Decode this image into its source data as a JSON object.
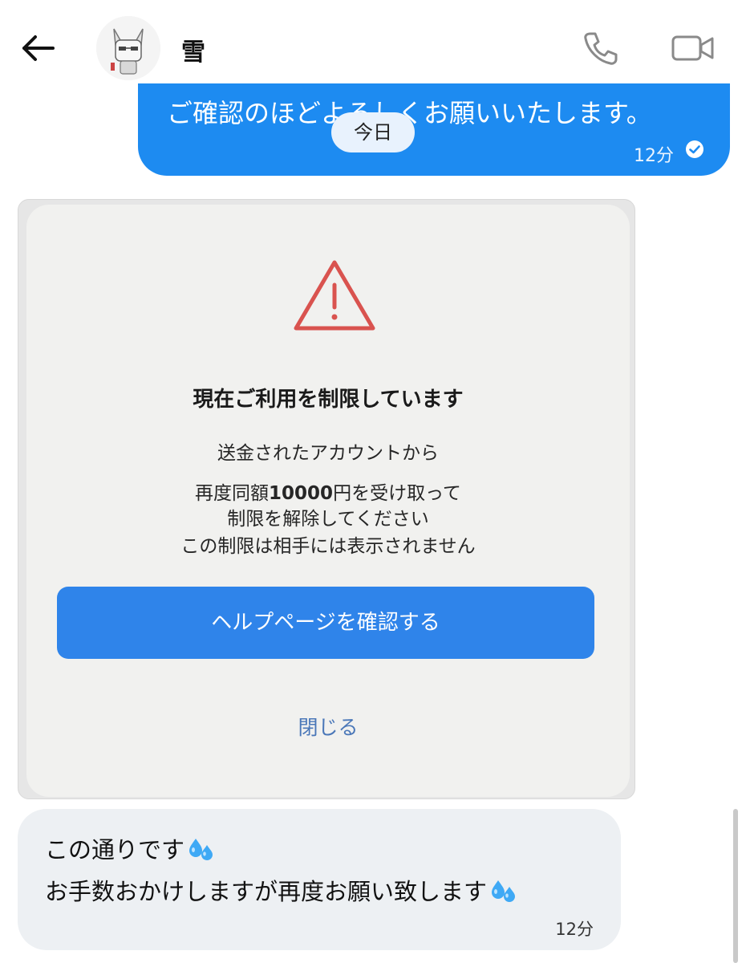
{
  "header": {
    "back_icon": "arrow-left-icon",
    "contact_name": "雪",
    "call_icon": "phone-icon",
    "video_icon": "video-camera-icon"
  },
  "messages": {
    "outgoing": {
      "text": "ご確認のほどよろしくお願いいたします。",
      "time": "12分",
      "status_icon": "read-check-icon"
    },
    "date_chip": "今日",
    "image_card": {
      "icon": "warning-triangle-icon",
      "title": "現在ご利用を制限しています",
      "line1": "送金されたアカウントから",
      "line2_prefix": "再度同額",
      "line2_amount": "10000",
      "line2_suffix": "円を受け取って",
      "line3": "制限を解除してください",
      "line4": "この制限は相手には表示されません",
      "button_label": "ヘルプページを確認する",
      "close_label": "閉じる"
    },
    "incoming": {
      "line1": "この通りです",
      "line2": "お手数おかけしますが再度お願い致します",
      "emoji": "sweat-droplets-icon",
      "time": "12分"
    }
  },
  "colors": {
    "bubble_out": "#1d8bf1",
    "bubble_in": "#edf0f3",
    "card_button": "#2f84ea",
    "warning": "#d9534f",
    "close_link": "#4a77b8"
  }
}
